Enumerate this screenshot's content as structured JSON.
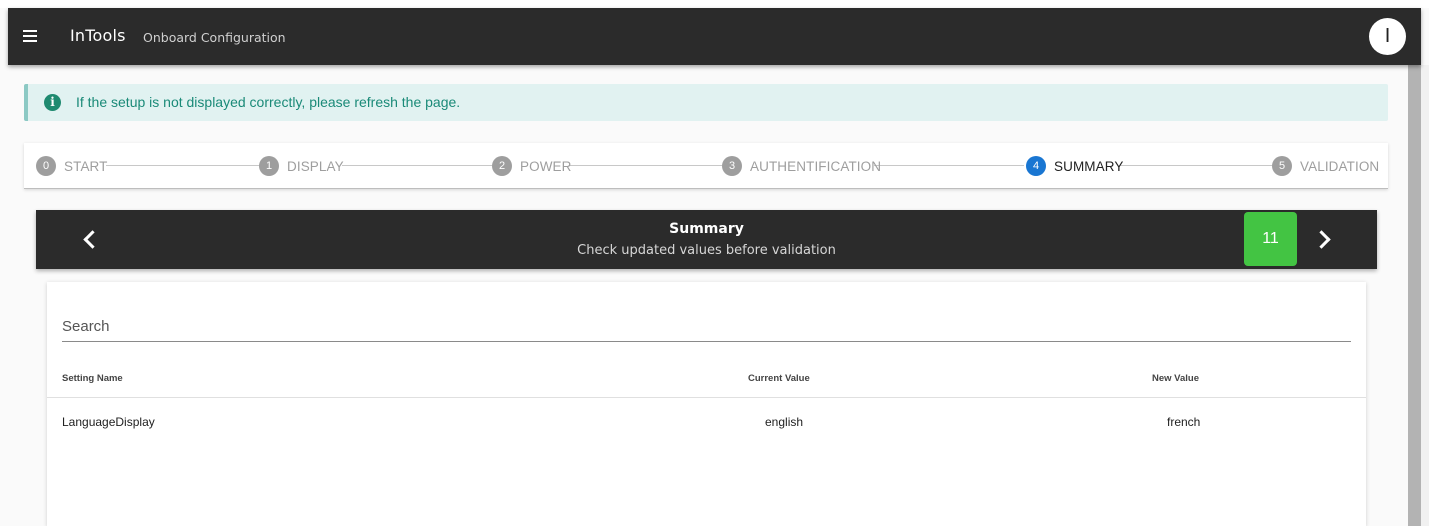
{
  "appbar": {
    "title": "InTools",
    "subtitle": "Onboard Configuration",
    "avatar_initial": "I"
  },
  "alert": {
    "icon": "info-icon",
    "text": "If the setup is not displayed correctly, please refresh the page.",
    "color": "#1a8a78"
  },
  "stepper": {
    "steps": [
      {
        "number": "0",
        "label": "START"
      },
      {
        "number": "1",
        "label": "DISPLAY"
      },
      {
        "number": "2",
        "label": "POWER"
      },
      {
        "number": "3",
        "label": "AUTHENTIFICATION"
      },
      {
        "number": "4",
        "label": "SUMMARY"
      },
      {
        "number": "5",
        "label": "VALIDATION"
      }
    ],
    "active_step": "4",
    "active_color": "#1976d2"
  },
  "step_header": {
    "title": "Summary",
    "subtitle": "Check updated values before validation",
    "count": "11",
    "count_color": "#43c443"
  },
  "summary_table": {
    "search_placeholder": "Search",
    "columns": [
      "Setting Name",
      "Current Value",
      "New Value"
    ],
    "rows": [
      {
        "setting_name": "LanguageDisplay",
        "current_value": "english",
        "new_value": "french"
      }
    ]
  }
}
